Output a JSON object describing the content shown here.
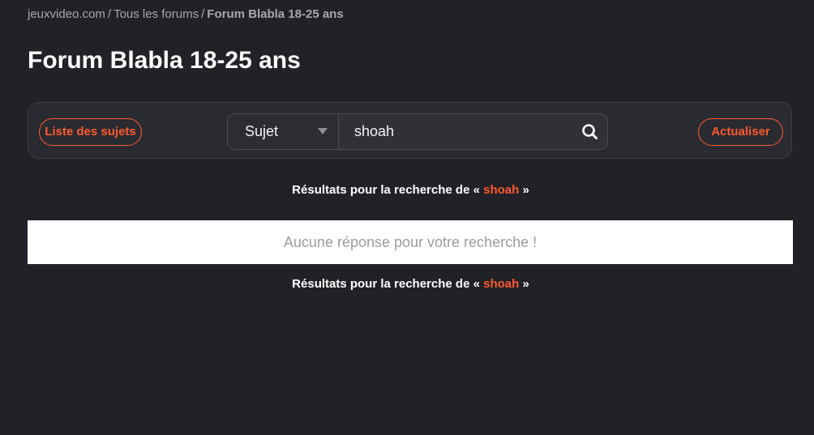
{
  "breadcrumb": {
    "home": "jeuxvideo.com",
    "separator": "/",
    "forums": "Tous les forums",
    "current": "Forum Blabla 18-25 ans"
  },
  "page_title": "Forum Blabla 18-25 ans",
  "toolbar": {
    "list_button": "Liste des sujets",
    "search_type": "Sujet",
    "search_value": "shoah",
    "search_icon": "search-icon",
    "refresh_button": "Actualiser"
  },
  "results": {
    "prefix": "Résultats pour la recherche de «",
    "query": "shoah",
    "suffix": "»"
  },
  "empty_message": "Aucune réponse pour votre recherche !",
  "colors": {
    "background": "#202227",
    "accent": "#ff5a2e",
    "panel": "#292b31"
  }
}
